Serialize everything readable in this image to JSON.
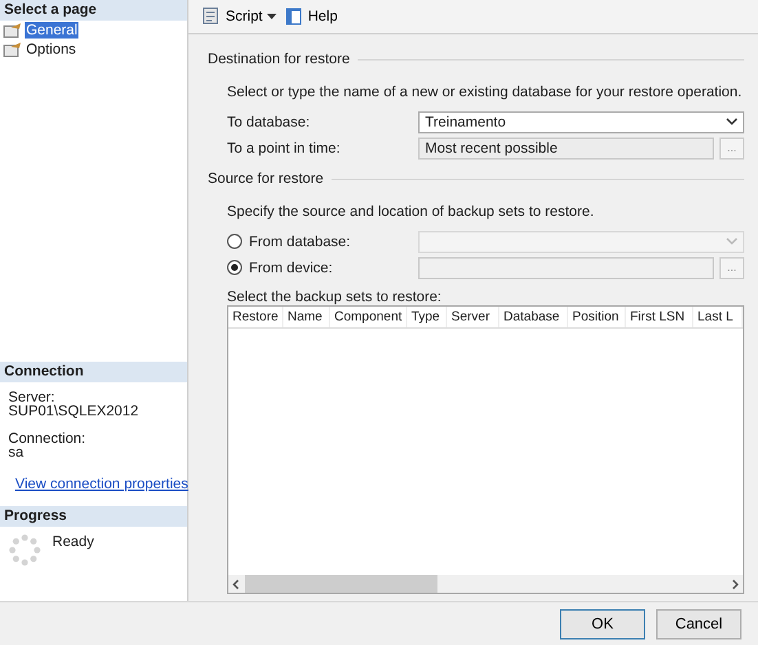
{
  "sidebar": {
    "header": "Select a page",
    "pages": [
      {
        "label": "General",
        "selected": true
      },
      {
        "label": "Options",
        "selected": false
      }
    ]
  },
  "connection": {
    "header": "Connection",
    "server_label": "Server:",
    "server": "SUP01\\SQLEX2012",
    "connection_label": "Connection:",
    "connection": "sa",
    "link": "View connection properties"
  },
  "progress": {
    "header": "Progress",
    "status": "Ready"
  },
  "toolbar": {
    "script": "Script",
    "help": "Help"
  },
  "destination": {
    "header": "Destination for restore",
    "description": "Select or type the name of a new or existing database for your restore operation.",
    "to_database_label": "To database:",
    "to_database": "Treinamento",
    "point_label": "To a point in time:",
    "point": "Most recent possible",
    "browse": "..."
  },
  "source": {
    "header": "Source for restore",
    "description": "Specify the source and location of backup sets to restore.",
    "options": [
      {
        "label": "From database:",
        "selected": false,
        "kind": "combo"
      },
      {
        "label": "From device:",
        "selected": true,
        "kind": "browse"
      }
    ],
    "browse": "...",
    "sets_label": "Select the backup sets to restore:"
  },
  "table": {
    "columns": [
      "Restore",
      "Name",
      "Component",
      "Type",
      "Server",
      "Database",
      "Position",
      "First LSN",
      "Last L"
    ]
  },
  "buttons": [
    "OK",
    "Cancel"
  ]
}
